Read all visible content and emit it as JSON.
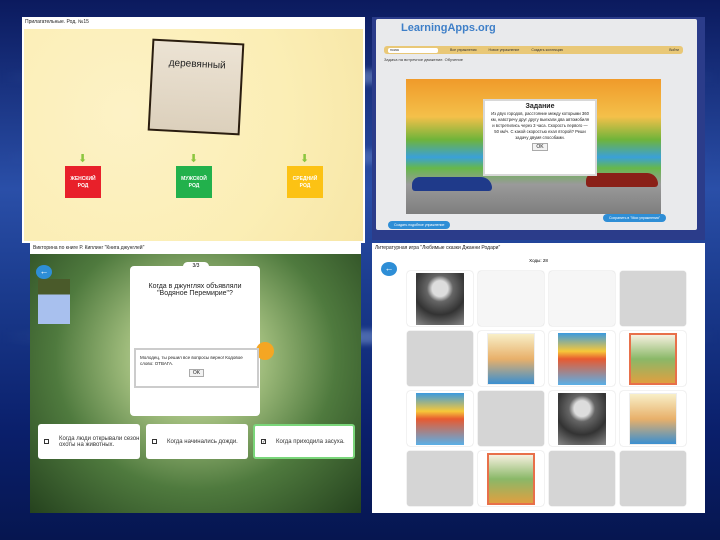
{
  "panel1": {
    "title": "Прилагательные. Род. №15",
    "word": "деревянный",
    "bins": [
      {
        "label": "ЖЕНСКИЙ РОД",
        "color": "#e8202a"
      },
      {
        "label": "МУЖСКОЙ РОД",
        "color": "#22b14c"
      },
      {
        "label": "СРЕДНИЙ РОД",
        "color": "#fcc214"
      }
    ]
  },
  "panel2": {
    "logo": "LearningApps.org",
    "search": "поиск",
    "nav": [
      "Все упражнения",
      "Новое упражнение",
      "Создать коллекцию"
    ],
    "login": "Войти",
    "exercise_title": "Задача на встречное движение. Обучение",
    "dialog_title": "Задание",
    "dialog_text": "Из двух городов, расстояние между которыми 360 км, навстречу друг другу выехали два автомобиля и встретились через 3 часа. Скорость первого — 50 км/ч. С какой скоростью ехал второй? Реши задачу двумя способами.",
    "ok": "OK",
    "create_similar": "Создать подобное упражнение",
    "save": "Сохранить в \"Мои упражнения\""
  },
  "panel3": {
    "title": "Викторина по книге Р. Киплинг \"Книга джунглей\"",
    "counter": "3/3",
    "question": "Когда в джунглях объявляли \"Водяное Перемирие\"?",
    "message": "Молодец, ты решил все вопросы верно! Кодовое слово: ОТВАГА.",
    "ok": "OK",
    "options": [
      {
        "text": "Когда люди открывали сезон охоты на животных.",
        "checked": false
      },
      {
        "text": "Когда начинались дожди.",
        "checked": false
      },
      {
        "text": "Когда приходила засуха.",
        "checked": true
      }
    ]
  },
  "panel4": {
    "title": "Литературная игра \"Любимые сказки Джанни Родари\"",
    "moves": "Ходы: 28",
    "cards": [
      "photo",
      "white",
      "white",
      "gray",
      "gray",
      "book1",
      "book2",
      "book3",
      "book2",
      "gray",
      "photo",
      "book1",
      "gray",
      "book3",
      "gray",
      "gray"
    ]
  }
}
